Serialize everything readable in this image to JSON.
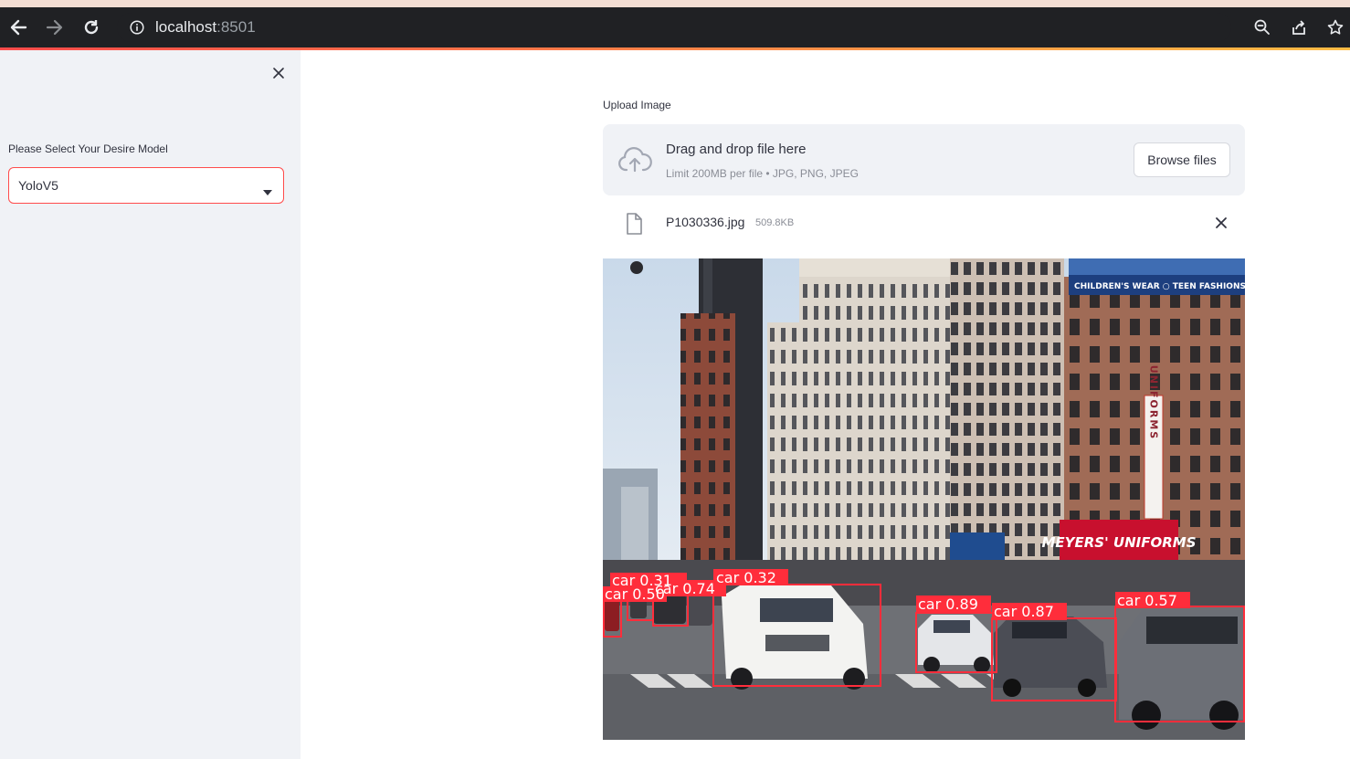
{
  "browser": {
    "url_host": "localhost",
    "url_port": ":8501",
    "icons": [
      "back-arrow-icon",
      "forward-arrow-icon",
      "reload-icon",
      "info-icon",
      "zoom-icon",
      "share-icon",
      "star-icon"
    ]
  },
  "sidebar": {
    "select_label": "Please Select Your Desire Model",
    "selected_model": "YoloV5"
  },
  "main": {
    "upload_label": "Upload Image",
    "dropzone_title": "Drag and drop file here",
    "dropzone_limit": "Limit 200MB per file • JPG, PNG, JPEG",
    "browse_label": "Browse files",
    "file_name": "P1030336.jpg",
    "file_size": "509.8KB"
  },
  "image": {
    "billboard_text": "CHILDREN'S WEAR ○ TEEN FASHIONS ○ S",
    "vertical_sign": "UNIFORMS",
    "store_sign": "MEYERS' UNIFORMS",
    "detections": [
      {
        "label": "car 0.31"
      },
      {
        "label": "car 0.50"
      },
      {
        "label": "car 0.74"
      },
      {
        "label": "car 0.32"
      },
      {
        "label": "car 0.89"
      },
      {
        "label": "car 0.87"
      },
      {
        "label": "car 0.57"
      }
    ]
  },
  "colors": {
    "accent": "#ff4b4b",
    "sidebar_bg": "#f0f2f6",
    "text": "#31333f",
    "box": "#ff2d3b"
  }
}
